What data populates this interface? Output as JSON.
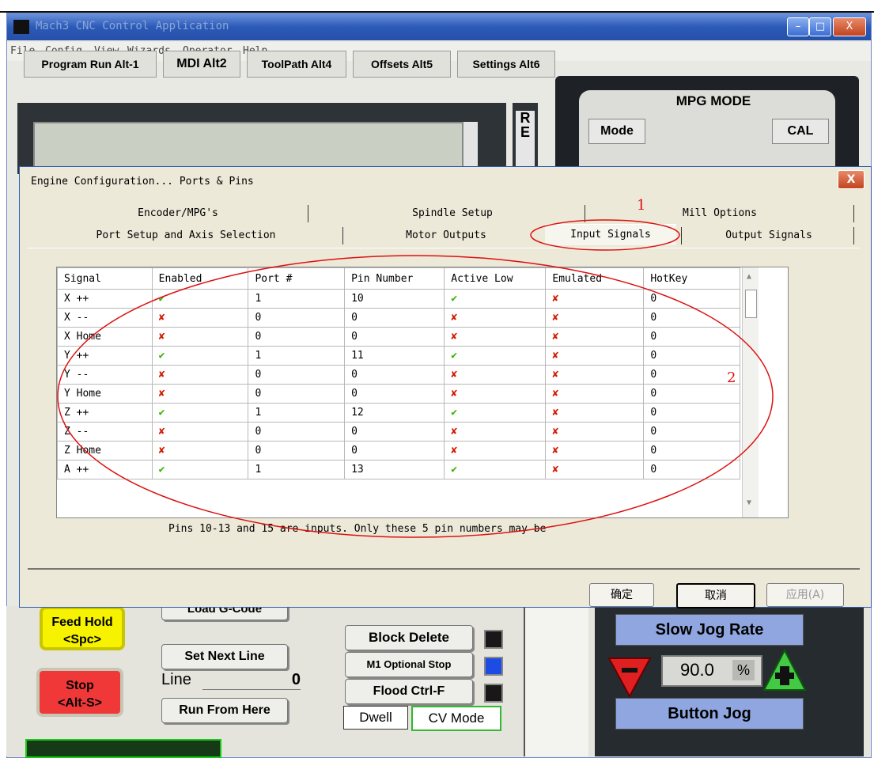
{
  "app": {
    "title": "Mach3 CNC Control Application",
    "controls": {
      "minimize": "–",
      "maximize": "□",
      "close": "X"
    }
  },
  "menu": [
    "File",
    "Config",
    "View",
    "Wizards",
    "Operator",
    "Help"
  ],
  "top_tabs": [
    "Program Run Alt-1",
    "MDI Alt2",
    "ToolPath Alt4",
    "Offsets Alt5",
    "Settings Alt6"
  ],
  "ref_label": "R\nE",
  "mpg": {
    "title": "MPG MODE",
    "mode": "Mode",
    "cal": "CAL"
  },
  "dialog": {
    "title": "Engine Configuration... Ports & Pins",
    "close": "X",
    "tabs_row1": [
      "Encoder/MPG's",
      "Spindle Setup",
      "Mill Options"
    ],
    "tabs_row2": [
      "Port Setup and Axis Selection",
      "Motor Outputs",
      "Input Signals",
      "Output Signals"
    ],
    "columns": [
      "Signal",
      "Enabled",
      "Port #",
      "Pin Number",
      "Active Low",
      "Emulated",
      "HotKey"
    ],
    "rows": [
      {
        "signal": "X ++",
        "enabled": "✔",
        "port": "1",
        "pin": "10",
        "active_low": "✔",
        "emulated": "✘",
        "hotkey": "0"
      },
      {
        "signal": "X --",
        "enabled": "✘",
        "port": "0",
        "pin": "0",
        "active_low": "✘",
        "emulated": "✘",
        "hotkey": "0"
      },
      {
        "signal": "X Home",
        "enabled": "✘",
        "port": "0",
        "pin": "0",
        "active_low": "✘",
        "emulated": "✘",
        "hotkey": "0"
      },
      {
        "signal": "Y ++",
        "enabled": "✔",
        "port": "1",
        "pin": "11",
        "active_low": "✔",
        "emulated": "✘",
        "hotkey": "0"
      },
      {
        "signal": "Y --",
        "enabled": "✘",
        "port": "0",
        "pin": "0",
        "active_low": "✘",
        "emulated": "✘",
        "hotkey": "0"
      },
      {
        "signal": "Y Home",
        "enabled": "✘",
        "port": "0",
        "pin": "0",
        "active_low": "✘",
        "emulated": "✘",
        "hotkey": "0"
      },
      {
        "signal": "Z ++",
        "enabled": "✔",
        "port": "1",
        "pin": "12",
        "active_low": "✔",
        "emulated": "✘",
        "hotkey": "0"
      },
      {
        "signal": "Z --",
        "enabled": "✘",
        "port": "0",
        "pin": "0",
        "active_low": "✘",
        "emulated": "✘",
        "hotkey": "0"
      },
      {
        "signal": "Z Home",
        "enabled": "✘",
        "port": "0",
        "pin": "0",
        "active_low": "✘",
        "emulated": "✘",
        "hotkey": "0"
      },
      {
        "signal": "A ++",
        "enabled": "✔",
        "port": "1",
        "pin": "13",
        "active_low": "✔",
        "emulated": "✘",
        "hotkey": "0"
      }
    ],
    "info_text": "Pins 10-13 and 15 are inputs. Only these 5 pin numbers may be",
    "buttons": {
      "ok": "确定",
      "cancel": "取消",
      "apply": "应用(A)"
    },
    "annotations": {
      "a1": "1",
      "a2": "2"
    }
  },
  "bottom": {
    "feed_hold": "Feed Hold\n<Spc>",
    "load_gcode": "Load G-Code",
    "stop": "Stop\n<Alt-S>",
    "set_next_line": "Set Next Line",
    "line_label": "Line",
    "line_value": "0",
    "run_from_here": "Run From Here",
    "block_delete": "Block Delete",
    "m1_optional_stop": "M1 Optional Stop",
    "flood": "Flood Ctrl-F",
    "dwell": "Dwell",
    "cv_mode": "CV Mode",
    "slow_jog_rate": "Slow Jog Rate",
    "jog_value": "90.0",
    "jog_unit": "%",
    "button_jog": "Button Jog"
  },
  "colors": {
    "accent": "#2c5ab8",
    "ok_check": "#35b400",
    "x_mark": "#d11a00",
    "annotation": "#dd1111"
  }
}
